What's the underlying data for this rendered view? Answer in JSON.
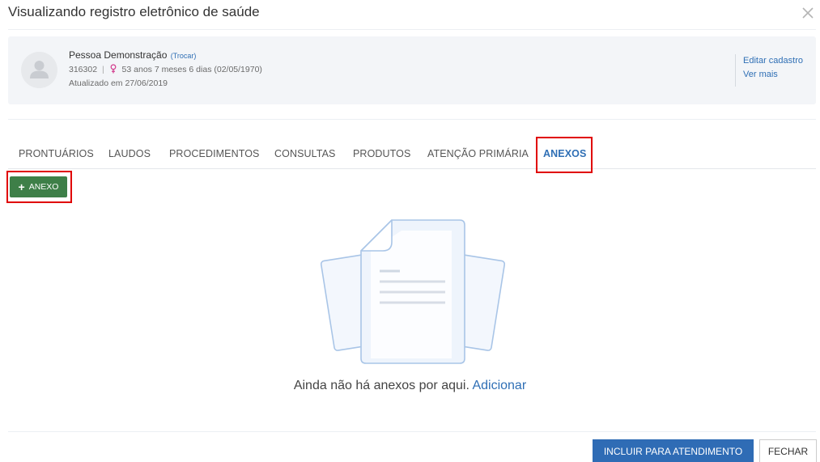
{
  "modal": {
    "title": "Visualizando registro eletrônico de saúde",
    "close_icon": "close-icon"
  },
  "patient": {
    "name": "Pessoa Demonstração",
    "switch_link": "(Trocar)",
    "id": "316302",
    "separator": "|",
    "gender_icon": "female-icon",
    "age": "53 anos 7 meses 6 dias (02/05/1970)",
    "updated": "Atualizado em 27/06/2019",
    "actions": {
      "edit": "Editar cadastro",
      "more": "Ver mais"
    }
  },
  "tabs": [
    {
      "label": "PRONTUÁRIOS",
      "active": false
    },
    {
      "label": "LAUDOS",
      "active": false
    },
    {
      "label": "PROCEDIMENTOS",
      "active": false
    },
    {
      "label": "CONSULTAS",
      "active": false
    },
    {
      "label": "PRODUTOS",
      "active": false
    },
    {
      "label": "ATENÇÃO PRIMÁRIA",
      "active": false
    },
    {
      "label": "ANEXOS",
      "active": true
    }
  ],
  "toolbar": {
    "add_icon": "+",
    "add_label": "ANEXO"
  },
  "empty_state": {
    "illustration": "documents-icon",
    "message": "Ainda não há anexos por aqui.",
    "action_link": "Adicionar"
  },
  "footer": {
    "primary_label": "INCLUIR PARA ATENDIMENTO",
    "close_label": "FECHAR"
  },
  "colors": {
    "accent_blue": "#2f6cb5",
    "success_green": "#3e7f48",
    "highlight_red": "#e00000",
    "card_background": "#f3f5f8"
  }
}
